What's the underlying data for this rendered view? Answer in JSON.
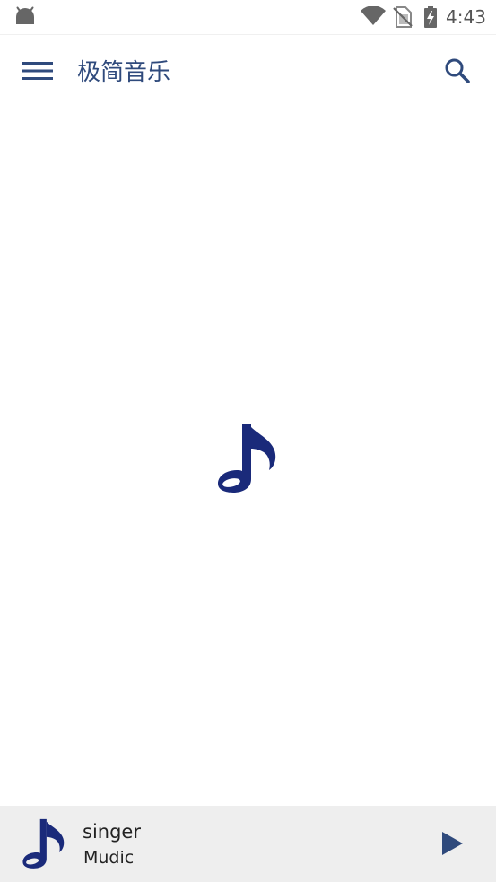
{
  "status_bar": {
    "time": "4:43",
    "icons": [
      "android-icon",
      "wifi-icon",
      "sim-off-icon",
      "battery-charging-icon"
    ]
  },
  "app_bar": {
    "title": "极简音乐",
    "menu_icon": "menu-icon",
    "search_icon": "search-icon"
  },
  "content": {
    "placeholder_icon": "music-note-icon"
  },
  "player": {
    "art_icon": "music-note-icon",
    "singer": "singer",
    "song": "Mudic",
    "play_icon": "play-icon"
  },
  "colors": {
    "accent": "#2f4a7c",
    "note": "#1a2a7a",
    "player_bg": "#eeeeee",
    "status_icon": "#666666"
  }
}
